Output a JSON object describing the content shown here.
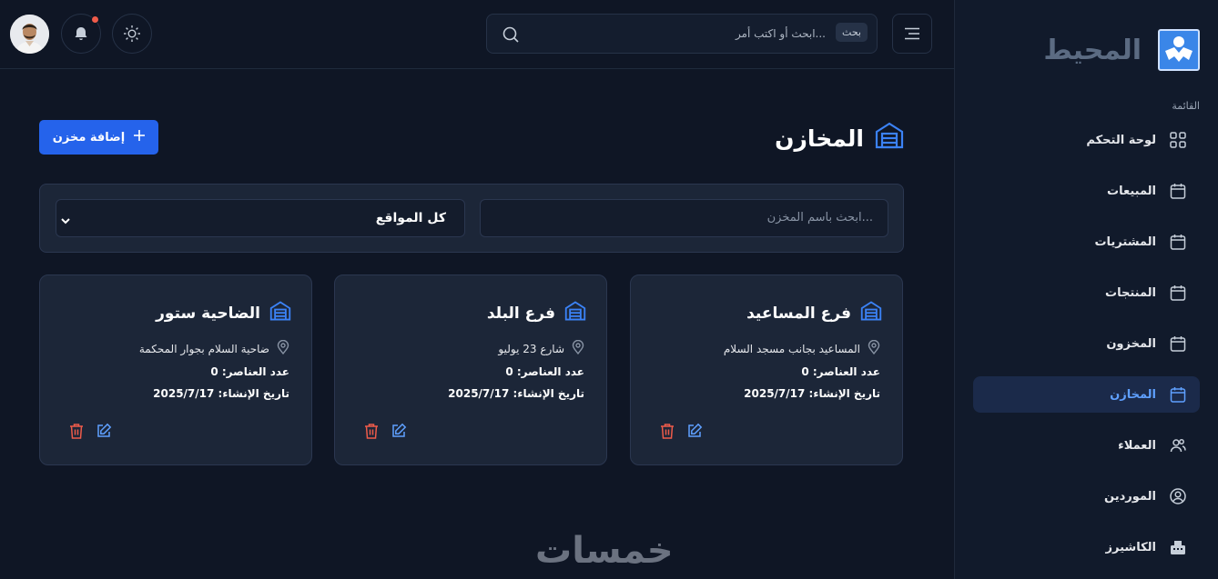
{
  "brand": {
    "name": "المحيط"
  },
  "sidebar": {
    "menu_title": "القائمة",
    "items": [
      {
        "label": "لوحة التحكم",
        "icon": "dashboard-icon"
      },
      {
        "label": "المبيعات",
        "icon": "calendar-icon"
      },
      {
        "label": "المشتريات",
        "icon": "calendar-icon"
      },
      {
        "label": "المنتجات",
        "icon": "calendar-icon"
      },
      {
        "label": "المخزون",
        "icon": "calendar-icon"
      },
      {
        "label": "المخازن",
        "icon": "calendar-icon",
        "active": true
      },
      {
        "label": "العملاء",
        "icon": "users-icon"
      },
      {
        "label": "الموردين",
        "icon": "user-circle-icon"
      },
      {
        "label": "الكاشيرز",
        "icon": "cashier-icon"
      }
    ]
  },
  "header": {
    "search_kbd": "بحث",
    "search_placeholder": "ابحث أو اكتب أمر..."
  },
  "page": {
    "title": "المخازن",
    "add_button": "إضافة مخزن"
  },
  "filters": {
    "search_placeholder": "ابحث باسم المخزن...",
    "location_value": "كل المواقع"
  },
  "warehouses": [
    {
      "name": "فرع المساعيد",
      "location": "المساعيد بجانب مسجد السلام",
      "items": "عدد العناصر: 0",
      "created": "تاريخ الإنشاء: 2025/7/17"
    },
    {
      "name": "فرع البلد",
      "location": "شارع 23 يوليو",
      "items": "عدد العناصر: 0",
      "created": "تاريخ الإنشاء: 2025/7/17"
    },
    {
      "name": "الضاحية ستور",
      "location": "ضاحية السلام بجوار المحكمة",
      "items": "عدد العناصر: 0",
      "created": "تاريخ الإنشاء: 2025/7/17"
    }
  ],
  "watermark": "خمسات",
  "colors": {
    "accent": "#2563eb",
    "active_text": "#5fa0ff",
    "danger": "#ef5b4a",
    "bg": "#0f1625",
    "card": "#1c2638"
  }
}
